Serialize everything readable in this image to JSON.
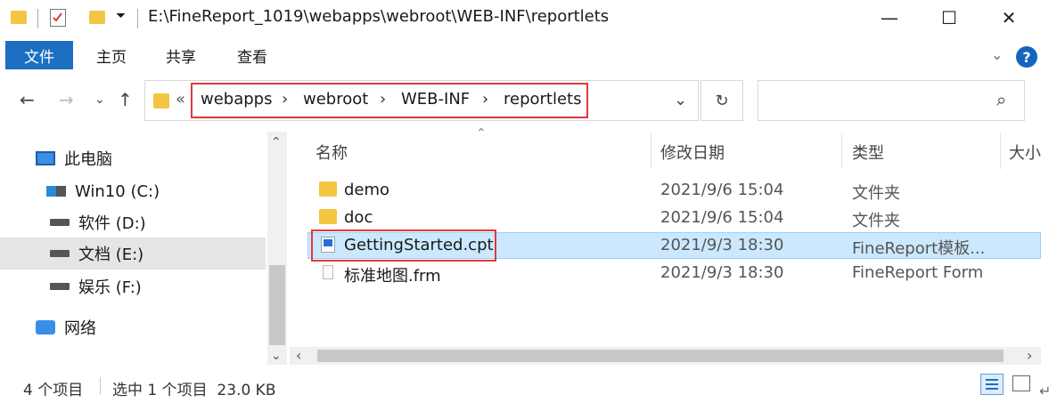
{
  "window": {
    "path": "E:\\FineReport_1019\\webapps\\webroot\\WEB-INF\\reportlets",
    "minimize_glyph": "—",
    "maximize_glyph": "☐",
    "close_glyph": "✕"
  },
  "ribbon": {
    "tabs": [
      "文件",
      "主页",
      "共享",
      "查看"
    ],
    "help_glyph": "?"
  },
  "address": {
    "overflow": "«",
    "crumbs": [
      "webapps",
      "webroot",
      "WEB-INF",
      "reportlets"
    ],
    "separator": "›",
    "dropdown_glyph": "⌄",
    "refresh_glyph": "↻",
    "search_glyph": "⌕",
    "search_placeholder": ""
  },
  "sidebar": {
    "items": [
      {
        "label": "此电脑",
        "icon": "computer-icon"
      },
      {
        "label": "Win10 (C:)",
        "icon": "windows-drive-icon"
      },
      {
        "label": "软件 (D:)",
        "icon": "drive-icon"
      },
      {
        "label": "文档 (E:)",
        "icon": "drive-icon",
        "selected": true
      },
      {
        "label": "娱乐 (F:)",
        "icon": "drive-icon"
      },
      {
        "label": "网络",
        "icon": "network-icon"
      }
    ]
  },
  "list": {
    "headers": [
      "名称",
      "修改日期",
      "类型",
      "大小"
    ],
    "rows": [
      {
        "name": "demo",
        "date": "2021/9/6 15:04",
        "type": "文件夹",
        "icon": "folder-icon"
      },
      {
        "name": "doc",
        "date": "2021/9/6 15:04",
        "type": "文件夹",
        "icon": "folder-icon"
      },
      {
        "name": "GettingStarted.cpt",
        "date": "2021/9/3 18:30",
        "type": "FineReport模板...",
        "icon": "cpt-file-icon",
        "selected": true
      },
      {
        "name": "标准地图.frm",
        "date": "2021/9/3 18:30",
        "type": "FineReport Form",
        "icon": "frm-file-icon"
      }
    ]
  },
  "status": {
    "count": "4 个项目",
    "selection": "选中 1 个项目  23.0 KB"
  },
  "colors": {
    "accent": "#1c6fc2",
    "highlight_box": "#e0393b",
    "selected_row": "#cce8ff"
  }
}
